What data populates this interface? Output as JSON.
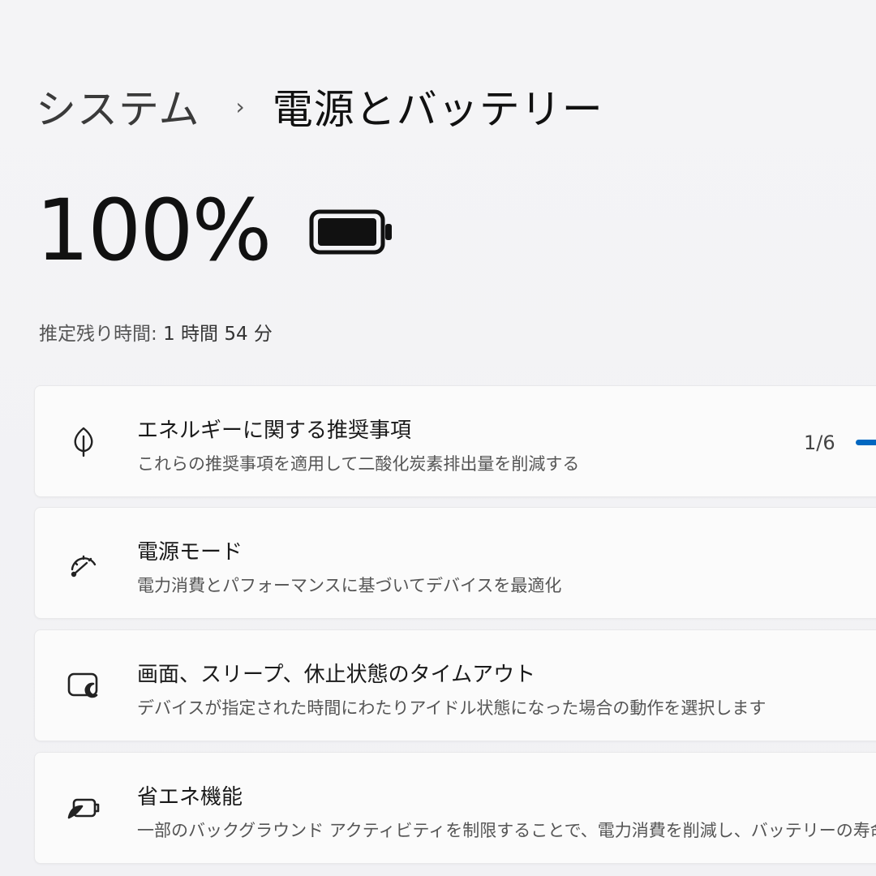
{
  "breadcrumb": {
    "parent": "システム",
    "separator": "›",
    "current": "電源とバッテリー"
  },
  "battery": {
    "percent_text": "100%",
    "level": 1.0,
    "icon": "battery-full-icon"
  },
  "remaining": {
    "label": "推定残り時間:",
    "value": "1 時間 54 分"
  },
  "cards": [
    {
      "icon": "leaf-icon",
      "title": "エネルギーに関する推奨事項",
      "description": "これらの推奨事項を適用して二酸化炭素排出量を削減する",
      "counter": "1/6"
    },
    {
      "icon": "gauge-icon",
      "title": "電源モード",
      "description": "電力消費とパフォーマンスに基づいてデバイスを最適化"
    },
    {
      "icon": "screen-sleep-icon",
      "title": "画面、スリープ、休止状態のタイムアウト",
      "description": "デバイスが指定された時間にわたりアイドル状態になった場合の動作を選択します"
    },
    {
      "icon": "battery-saver-icon",
      "title": "省エネ機能",
      "description": "一部のバックグラウンド アクティビティを制限することで、電力消費を削減し、バッテリーの寿命を"
    }
  ],
  "colors": {
    "accent": "#0067c0",
    "background": "#f3f3f5",
    "card": "#fbfbfb"
  }
}
